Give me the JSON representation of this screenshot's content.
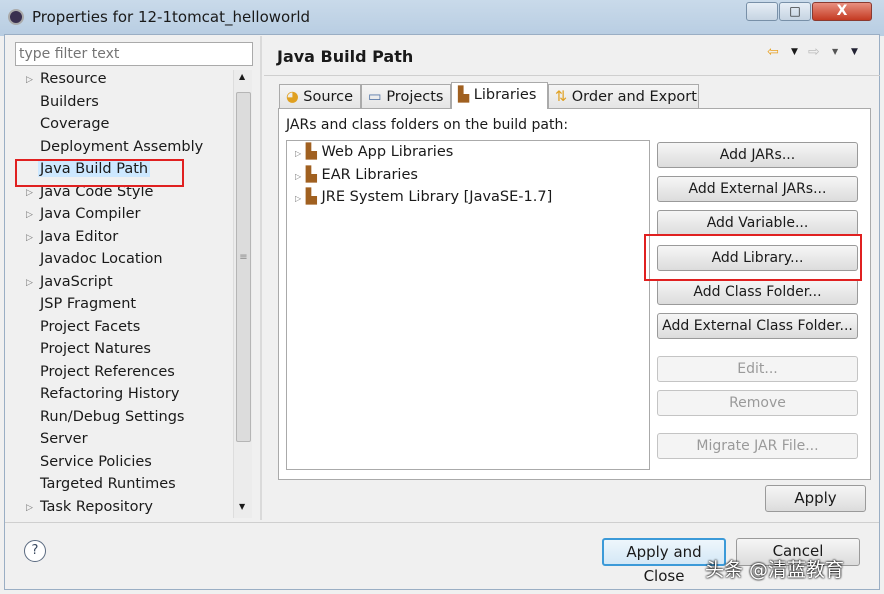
{
  "window": {
    "title": "Properties for 12-1tomcat_helloworld"
  },
  "filter": {
    "placeholder": "type filter text"
  },
  "tree": [
    {
      "label": "Resource",
      "expandable": true
    },
    {
      "label": "Builders",
      "expandable": false
    },
    {
      "label": "Coverage",
      "expandable": false
    },
    {
      "label": "Deployment Assembly",
      "expandable": false
    },
    {
      "label": "Java Build Path",
      "expandable": false,
      "selected": true
    },
    {
      "label": "Java Code Style",
      "expandable": true
    },
    {
      "label": "Java Compiler",
      "expandable": true
    },
    {
      "label": "Java Editor",
      "expandable": true
    },
    {
      "label": "Javadoc Location",
      "expandable": false
    },
    {
      "label": "JavaScript",
      "expandable": true
    },
    {
      "label": "JSP Fragment",
      "expandable": false
    },
    {
      "label": "Project Facets",
      "expandable": false
    },
    {
      "label": "Project Natures",
      "expandable": false
    },
    {
      "label": "Project References",
      "expandable": false
    },
    {
      "label": "Refactoring History",
      "expandable": false
    },
    {
      "label": "Run/Debug Settings",
      "expandable": false
    },
    {
      "label": "Server",
      "expandable": false
    },
    {
      "label": "Service Policies",
      "expandable": false
    },
    {
      "label": "Targeted Runtimes",
      "expandable": false
    },
    {
      "label": "Task Repository",
      "expandable": true
    }
  ],
  "page": {
    "title": "Java Build Path"
  },
  "tabs": [
    {
      "label": "Source"
    },
    {
      "label": "Projects"
    },
    {
      "label": "Libraries",
      "active": true
    },
    {
      "label": "Order and Export"
    }
  ],
  "libraries": {
    "caption": "JARs and class folders on the build path:",
    "items": [
      "Web App Libraries",
      "EAR Libraries",
      "JRE System Library [JavaSE-1.7]"
    ]
  },
  "buttons": {
    "add_jars": "Add JARs...",
    "add_external_jars": "Add External JARs...",
    "add_variable": "Add Variable...",
    "add_library": "Add Library...",
    "add_class_folder": "Add Class Folder...",
    "add_external_class_folder": "Add External Class Folder...",
    "edit": "Edit...",
    "remove": "Remove",
    "migrate": "Migrate JAR File...",
    "apply": "Apply",
    "apply_close": "Apply and Close",
    "cancel": "Cancel"
  },
  "watermark": "头条 @清蓝教育",
  "colors": {
    "highlight": "#e02020",
    "selection": "#cde8ff"
  }
}
